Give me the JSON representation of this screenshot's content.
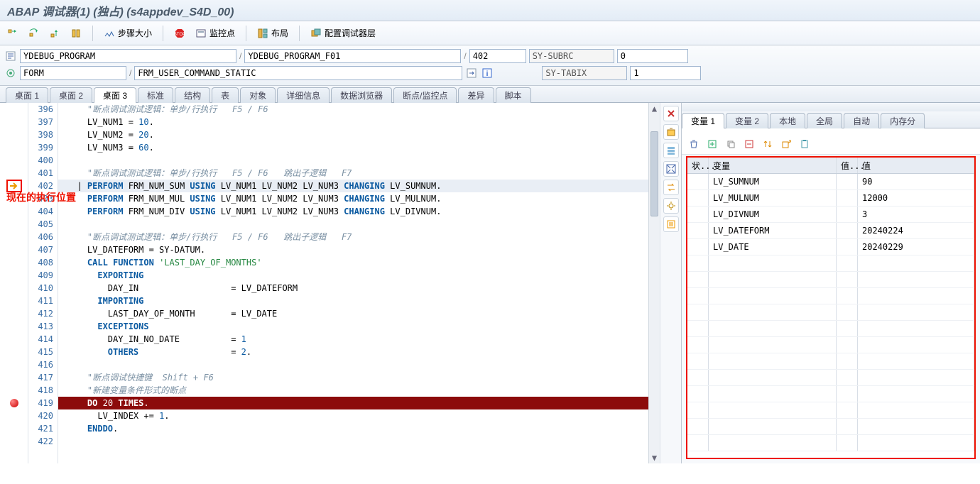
{
  "title": "ABAP 调试器(1) (独占) (s4appdev_S4D_00)",
  "toolbar": {
    "step_size": "步骤大小",
    "watchpoint": "监控点",
    "layout": "布局",
    "config_layers": "配置调试器层"
  },
  "info": {
    "program": "YDEBUG_PROGRAM",
    "include": "YDEBUG_PROGRAM_F01",
    "line": "402",
    "sy_subrc_lbl": "SY-SUBRC",
    "sy_subrc_val": "0",
    "event": "FORM",
    "form": "FRM_USER_COMMAND_STATIC",
    "sy_tabix_lbl": "SY-TABIX",
    "sy_tabix_val": "1"
  },
  "main_tabs": [
    "桌面 1",
    "桌面 2",
    "桌面 3",
    "标准",
    "结构",
    "表",
    "对象",
    "详细信息",
    "数据浏览器",
    "断点/监控点",
    "差异",
    "脚本"
  ],
  "main_tabs_active": 2,
  "var_tabs": [
    "变量 1",
    "变量 2",
    "本地",
    "全局",
    "自动",
    "内存分"
  ],
  "var_tabs_active": 0,
  "vars_header": {
    "c0": "状...",
    "c1": "变量",
    "c2": "值...",
    "c3": "值"
  },
  "vars": [
    {
      "name": "LV_SUMNUM",
      "value": "90"
    },
    {
      "name": "LV_MULNUM",
      "value": "12000"
    },
    {
      "name": "LV_DIVNUM",
      "value": "3"
    },
    {
      "name": "LV_DATEFORM",
      "value": "20240224"
    },
    {
      "name": "LV_DATE",
      "value": "20240229"
    }
  ],
  "exec_pos_label": "现在的执行位置",
  "code": {
    "start": 396,
    "current": 402,
    "breakpoint": 419,
    "lines": [
      {
        "n": 396,
        "cls": "",
        "html": "    <span class=\"cm\">\"断点调试测试逻辑：单步/行执行   F5 / F6</span>"
      },
      {
        "n": 397,
        "cls": "",
        "html": "    LV_NUM1 <span class=\"op\">=</span> <span class=\"nm\">10</span>."
      },
      {
        "n": 398,
        "cls": "",
        "html": "    LV_NUM2 <span class=\"op\">=</span> <span class=\"nm\">20</span>."
      },
      {
        "n": 399,
        "cls": "",
        "html": "    LV_NUM3 <span class=\"op\">=</span> <span class=\"nm\">60</span>."
      },
      {
        "n": 400,
        "cls": "",
        "html": "    "
      },
      {
        "n": 401,
        "cls": "",
        "html": "    <span class=\"cm\">\"断点调试测试逻辑：单步/行执行   F5 / F6   跳出子逻辑   F7</span>"
      },
      {
        "n": 402,
        "cls": "hl-current",
        "html": "  | <span class=\"kw\">PERFORM</span> FRM_NUM_SUM <span class=\"kw\">USING</span> LV_NUM1 LV_NUM2 LV_NUM3 <span class=\"kw\">CHANGING</span> LV_SUMNUM."
      },
      {
        "n": 403,
        "cls": "",
        "html": "    <span class=\"kw\">PERFORM</span> FRM_NUM_MUL <span class=\"kw\">USING</span> LV_NUM1 LV_NUM2 LV_NUM3 <span class=\"kw\">CHANGING</span> LV_MULNUM."
      },
      {
        "n": 404,
        "cls": "",
        "html": "    <span class=\"kw\">PERFORM</span> FRM_NUM_DIV <span class=\"kw\">USING</span> LV_NUM1 LV_NUM2 LV_NUM3 <span class=\"kw\">CHANGING</span> LV_DIVNUM."
      },
      {
        "n": 405,
        "cls": "",
        "html": ""
      },
      {
        "n": 406,
        "cls": "",
        "html": "    <span class=\"cm\">\"断点调试测试逻辑：单步/行执行   F5 / F6   跳出子逻辑   F7</span>"
      },
      {
        "n": 407,
        "cls": "",
        "html": "    LV_DATEFORM <span class=\"op\">=</span> SY-DATUM."
      },
      {
        "n": 408,
        "cls": "",
        "html": "    <span class=\"kw\">CALL FUNCTION</span> <span class=\"st\">'LAST_DAY_OF_MONTHS'</span>"
      },
      {
        "n": 409,
        "cls": "",
        "html": "      <span class=\"kw\">EXPORTING</span>"
      },
      {
        "n": 410,
        "cls": "",
        "html": "        DAY_IN                  <span class=\"op\">=</span> LV_DATEFORM"
      },
      {
        "n": 411,
        "cls": "",
        "html": "      <span class=\"kw\">IMPORTING</span>"
      },
      {
        "n": 412,
        "cls": "",
        "html": "        LAST_DAY_OF_MONTH       <span class=\"op\">=</span> LV_DATE"
      },
      {
        "n": 413,
        "cls": "",
        "html": "      <span class=\"kw\">EXCEPTIONS</span>"
      },
      {
        "n": 414,
        "cls": "",
        "html": "        DAY_IN_NO_DATE          <span class=\"op\">=</span> <span class=\"nm\">1</span>"
      },
      {
        "n": 415,
        "cls": "",
        "html": "        <span class=\"kw\">OTHERS</span>                  <span class=\"op\">=</span> <span class=\"nm\">2</span>."
      },
      {
        "n": 416,
        "cls": "",
        "html": ""
      },
      {
        "n": 417,
        "cls": "",
        "html": "    <span class=\"cm\">\"断点调试快捷键  Shift + F6</span>"
      },
      {
        "n": 418,
        "cls": "",
        "html": "    <span class=\"cm\">\"新建变量条件形式的断点</span>"
      },
      {
        "n": 419,
        "cls": "hl-stop",
        "html": "    <span class=\"kw\">DO</span> <span class=\"nm\">20</span> <span class=\"kw\">TIMES</span>."
      },
      {
        "n": 420,
        "cls": "",
        "html": "      LV_INDEX <span class=\"op\">+=</span> <span class=\"nm\">1</span>."
      },
      {
        "n": 421,
        "cls": "",
        "html": "    <span class=\"kw\">ENDDO</span>."
      },
      {
        "n": 422,
        "cls": "",
        "html": ""
      }
    ]
  }
}
